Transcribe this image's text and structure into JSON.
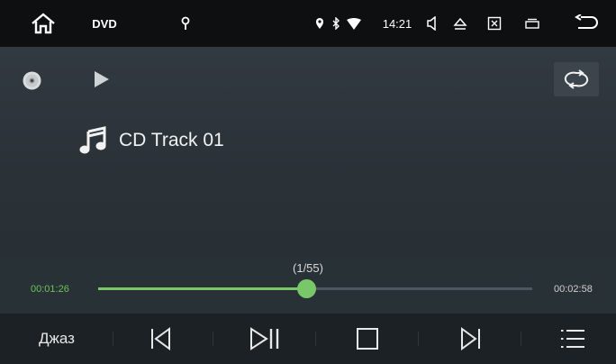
{
  "status_bar": {
    "source_label": "DVD",
    "time": "14:21",
    "icons": [
      "home-icon",
      "antenna-icon",
      "location-icon",
      "bluetooth-icon",
      "wifi-icon",
      "volume-icon",
      "eject-icon",
      "close-window-icon",
      "recent-apps-icon",
      "back-icon"
    ]
  },
  "player": {
    "state": "playing",
    "track_title": "CD Track 01",
    "track_counter": "(1/55)",
    "elapsed": "00:01:26",
    "total": "00:02:58",
    "progress_fraction": 0.48
  },
  "controls": {
    "eq_label": "Джаз",
    "buttons": [
      "previous-icon",
      "play-pause-icon",
      "stop-icon",
      "next-icon",
      "playlist-icon"
    ]
  },
  "colors": {
    "accent": "#7ac76a",
    "status_bar_bg": "#0e0f10",
    "main_bg": "#2b3237"
  }
}
